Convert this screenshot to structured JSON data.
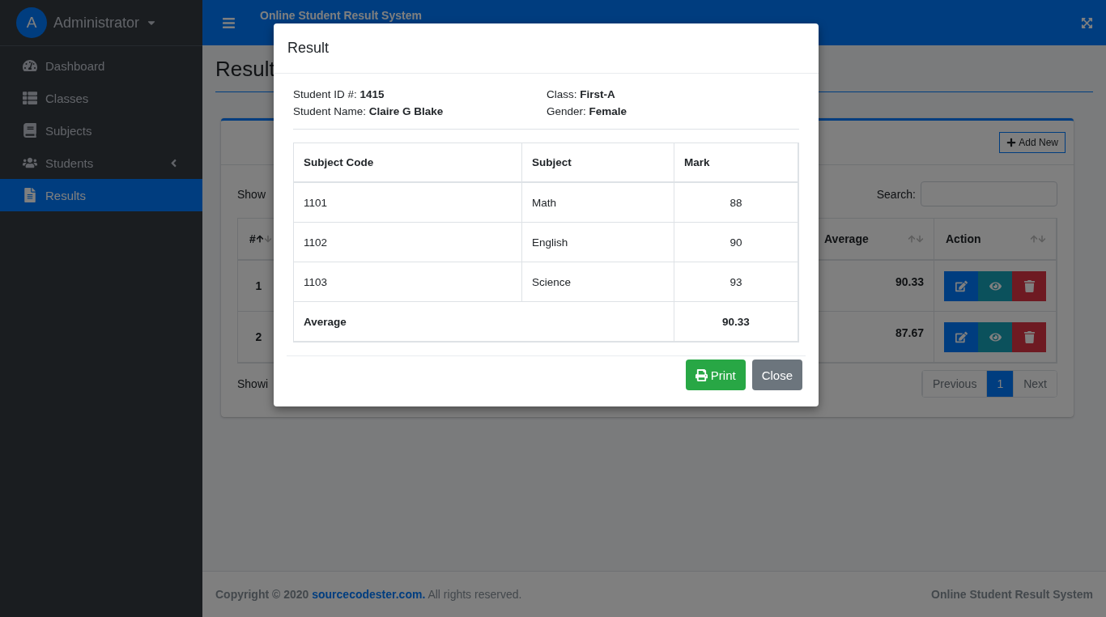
{
  "sidebar": {
    "user": {
      "initial": "A",
      "name": "Administrator"
    },
    "items": [
      {
        "label": "Dashboard",
        "selected": false,
        "has_submenu": false
      },
      {
        "label": "Classes",
        "selected": false,
        "has_submenu": false
      },
      {
        "label": "Subjects",
        "selected": false,
        "has_submenu": false
      },
      {
        "label": "Students",
        "selected": false,
        "has_submenu": true
      },
      {
        "label": "Results",
        "selected": true,
        "has_submenu": false
      }
    ]
  },
  "topbar": {
    "title": "Online Student Result System"
  },
  "page": {
    "heading": "Result",
    "add_button": "Add New",
    "show_label": "Show",
    "search_label": "Search:",
    "info_text": "Showi",
    "columns": [
      {
        "label": "#",
        "sorted": true
      },
      {
        "label": "Average",
        "sorted": false
      },
      {
        "label": "Action",
        "sorted": false
      }
    ],
    "rows": [
      {
        "number": "1",
        "average": "90.33"
      },
      {
        "number": "2",
        "average": "87.67"
      }
    ],
    "pagination": [
      {
        "label": "Previous",
        "selected": false
      },
      {
        "label": "1",
        "selected": true
      },
      {
        "label": "Next",
        "selected": false
      }
    ]
  },
  "footer": {
    "prefix": "Copyright © 2020",
    "link": "sourcecodester.com.",
    "suffix": "All rights reserved.",
    "right": "Online Student Result System"
  },
  "modal": {
    "title": "Result",
    "info": [
      "Student ID #: **1415**",
      "Class: **First-A**",
      "Student Name: **Claire G Blake**",
      "Gender: **Female**"
    ],
    "columns": [
      "Subject Code",
      "Subject",
      "Mark"
    ],
    "rows": [
      {
        "code": "1101",
        "subject": "Math",
        "mark": "88"
      },
      {
        "code": "1102",
        "subject": "English",
        "mark": "90"
      },
      {
        "code": "1103",
        "subject": "Science",
        "mark": "93"
      }
    ],
    "total": {
      "label": "Average",
      "value": "90.33"
    },
    "buttons": [
      {
        "label": "Print",
        "kind": "print"
      },
      {
        "label": "Close",
        "kind": "close"
      }
    ]
  }
}
